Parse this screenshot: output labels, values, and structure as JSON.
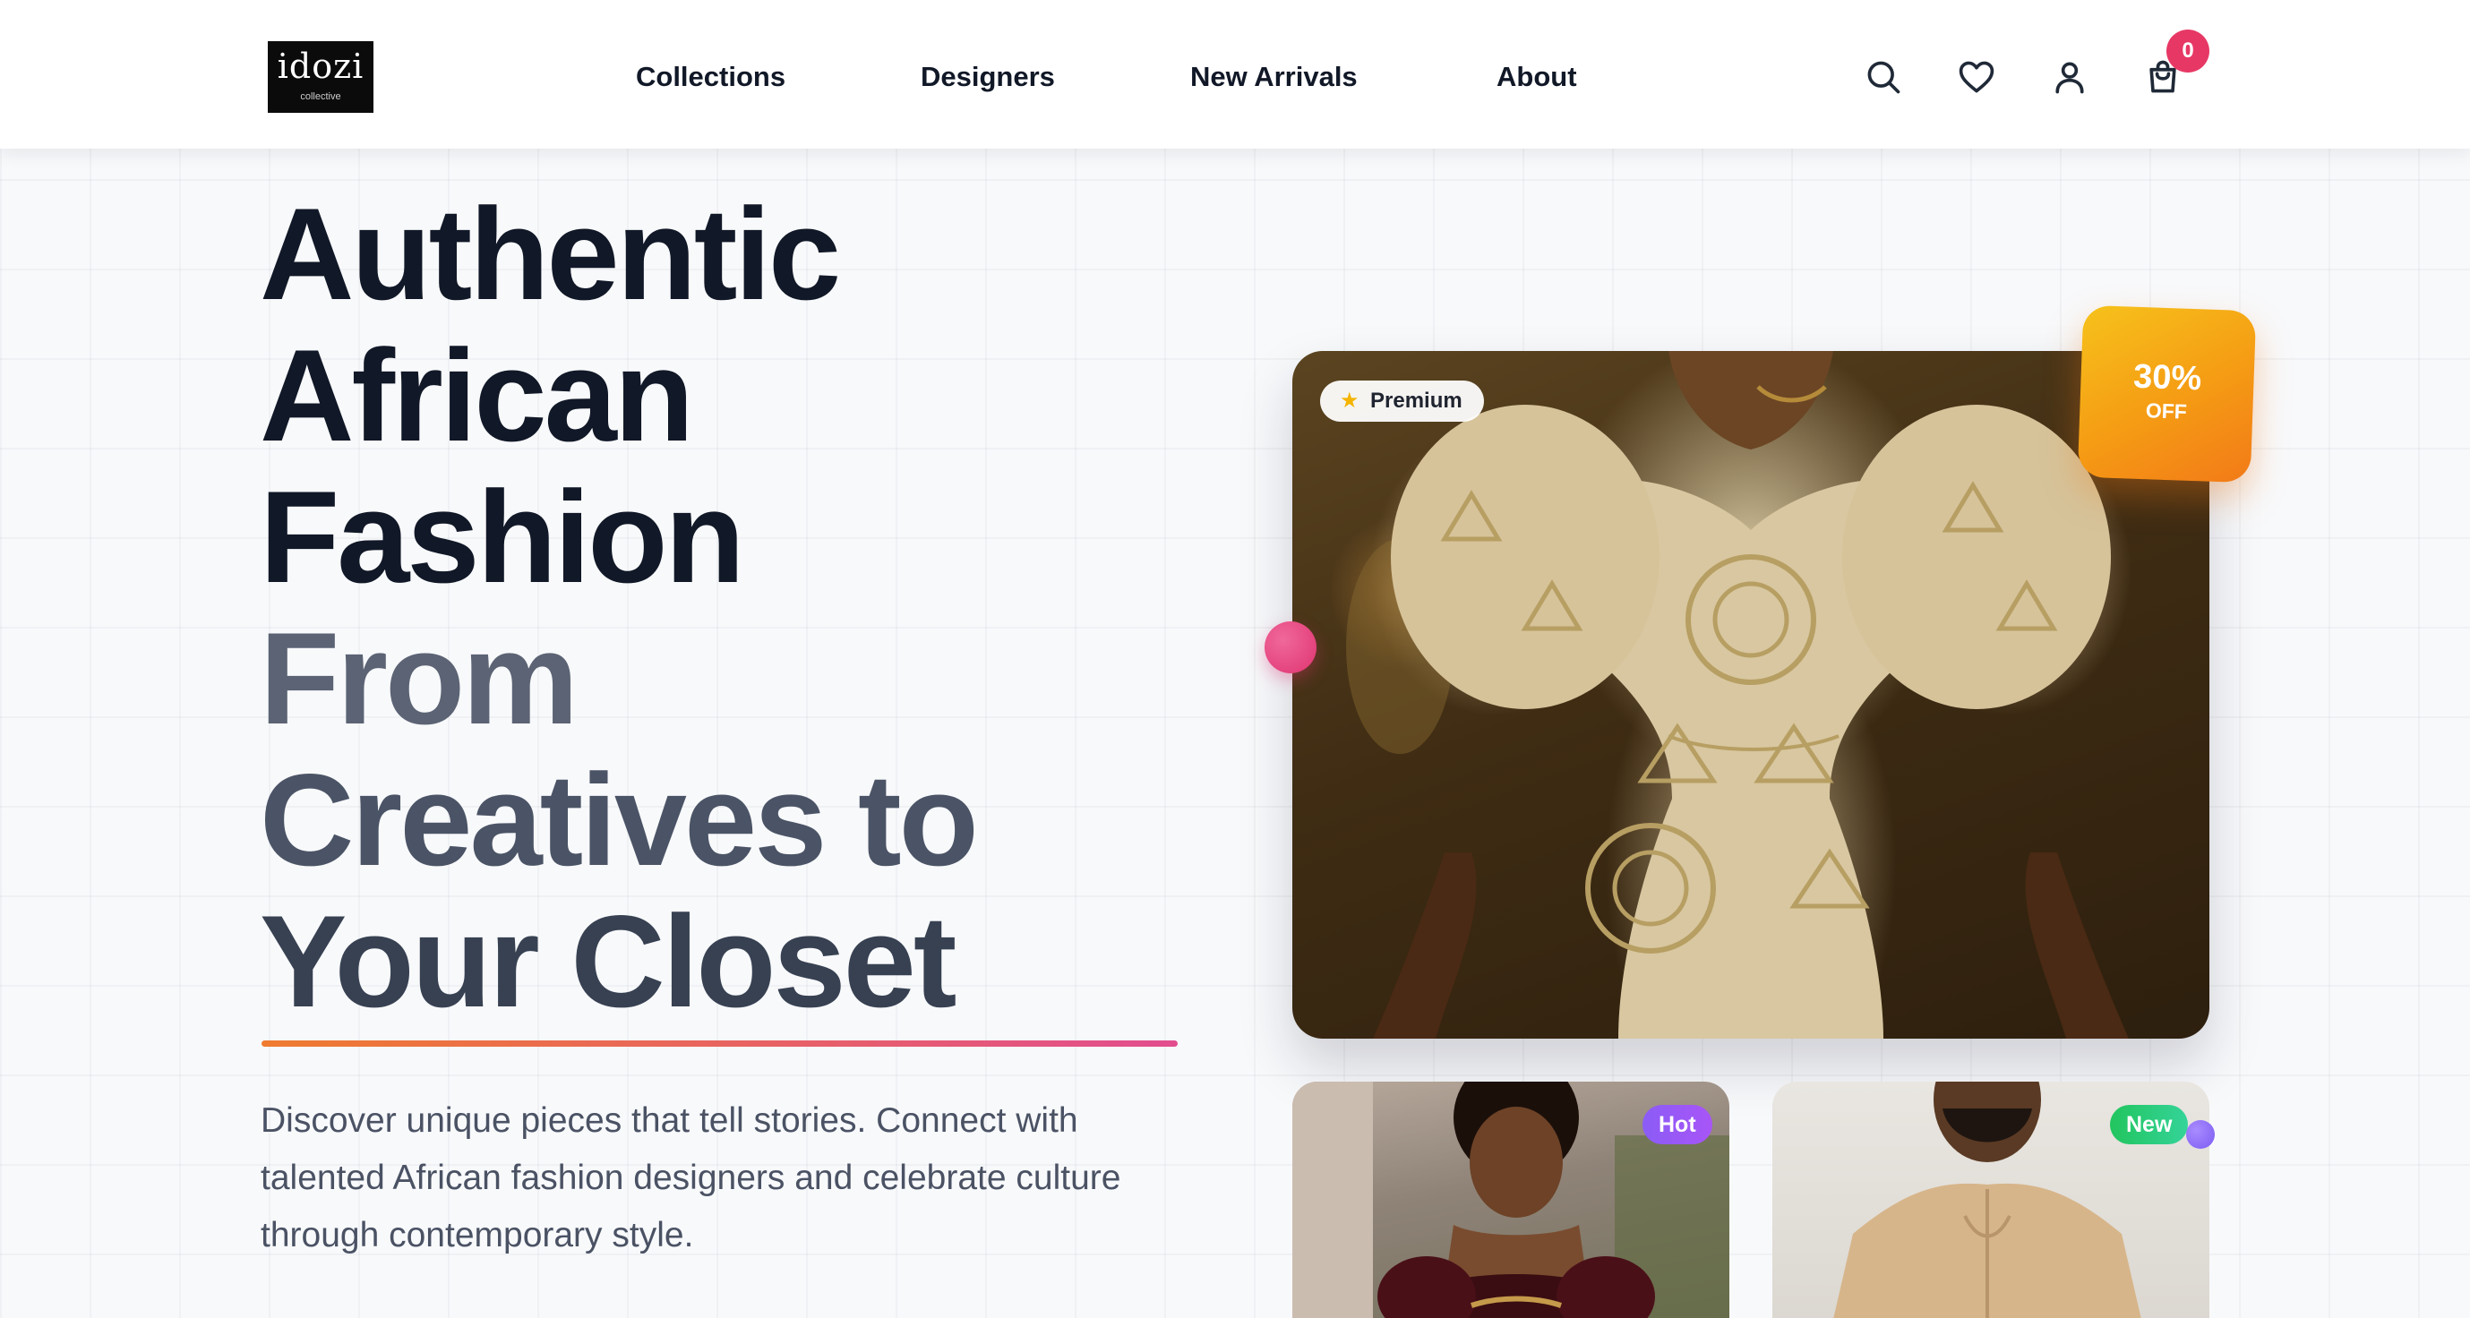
{
  "header": {
    "logo_text": "idozi",
    "logo_subtext": "collective",
    "nav": [
      "Collections",
      "Designers",
      "New Arrivals",
      "About"
    ],
    "cart_count": "0",
    "icons": [
      "search-icon",
      "heart-icon",
      "user-icon",
      "shopping-bag-icon"
    ]
  },
  "hero": {
    "headline_lines": [
      "Authentic",
      "African",
      "Fashion",
      "From",
      "Creatives to",
      "Your Closet"
    ],
    "description": "Discover unique pieces that tell stories. Connect with talented African fashion designers and celebrate culture through contemporary style."
  },
  "featured": {
    "premium_label": "Premium",
    "discount_value": "30%",
    "discount_label": "OFF"
  },
  "cards": [
    {
      "tag": "Hot"
    },
    {
      "tag": "New"
    }
  ],
  "colors": {
    "headline_dark": "#111827",
    "headline_grey": "#4b5466",
    "underline_start": "#ef7b2f",
    "underline_end": "#e24d8f",
    "badge": "#e73865",
    "discount": "#f59b14",
    "hot_tag": "#8b5cf6",
    "new_tag": "#22c55e"
  }
}
